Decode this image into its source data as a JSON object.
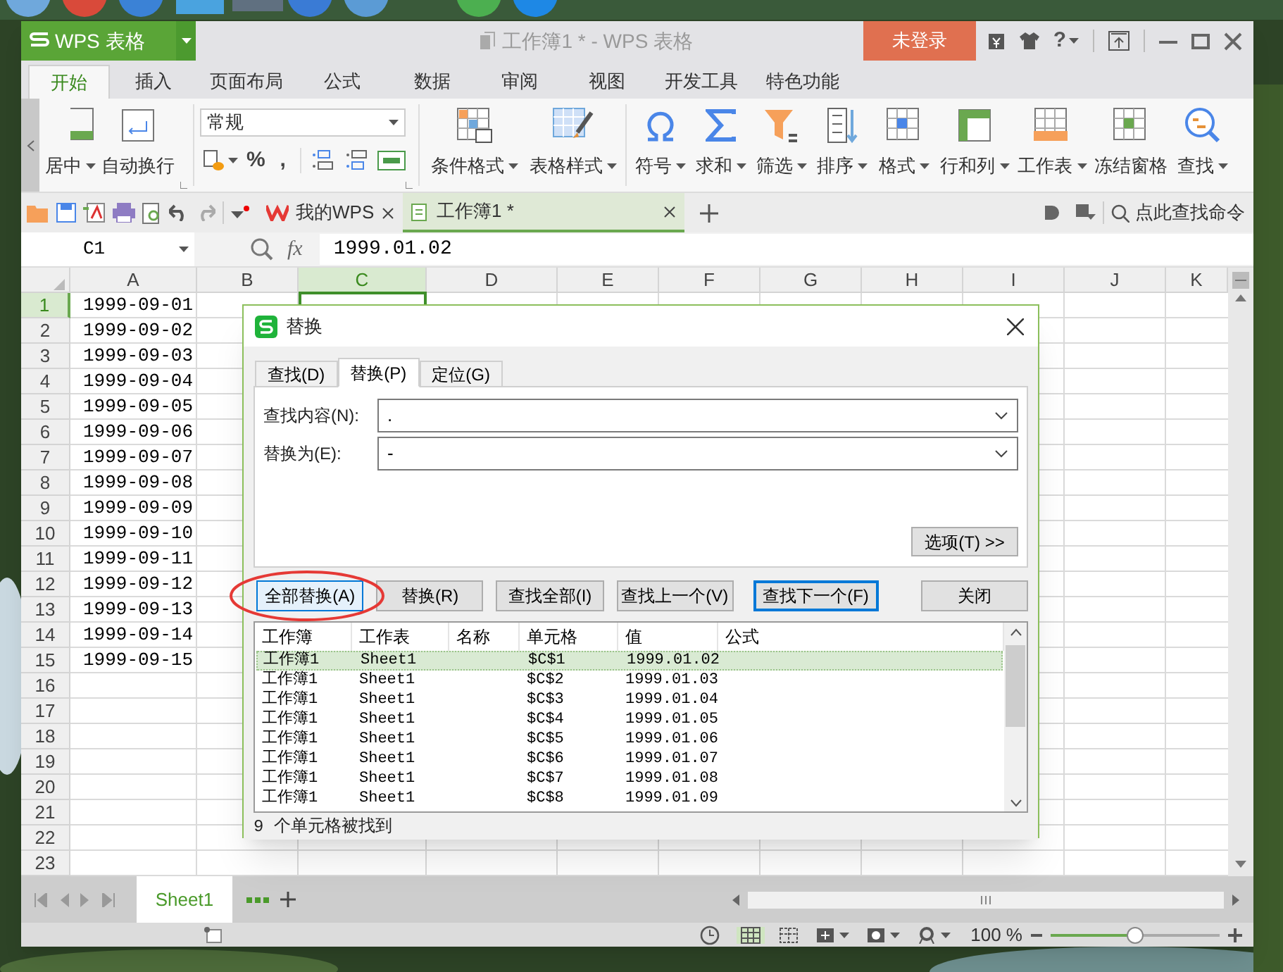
{
  "app_menu": {
    "label": "WPS 表格"
  },
  "window": {
    "title": "工作簿1 * - WPS 表格"
  },
  "login_button": "未登录",
  "help_button": "?",
  "ribbon_tabs": [
    {
      "label": "开始",
      "selected": true
    },
    {
      "label": "插入",
      "selected": false
    },
    {
      "label": "页面布局",
      "selected": false
    },
    {
      "label": "公式",
      "selected": false
    },
    {
      "label": "数据",
      "selected": false
    },
    {
      "label": "审阅",
      "selected": false
    },
    {
      "label": "视图",
      "selected": false
    },
    {
      "label": "开发工具",
      "selected": false
    },
    {
      "label": "特色功能",
      "selected": false
    }
  ],
  "ribbon": {
    "tools_left": [
      {
        "label": "居中",
        "dropdown": true
      },
      {
        "label": "自动换行",
        "dropdown": false
      }
    ],
    "number_format": {
      "value": "常规"
    },
    "number_symbols": [
      "%",
      ","
    ],
    "tools": [
      {
        "label": "条件格式",
        "dropdown": true
      },
      {
        "label": "表格样式",
        "dropdown": true
      },
      {
        "label": "符号",
        "dropdown": true
      },
      {
        "label": "求和",
        "dropdown": true
      },
      {
        "label": "筛选",
        "dropdown": true
      },
      {
        "label": "排序",
        "dropdown": true
      },
      {
        "label": "格式",
        "dropdown": true
      },
      {
        "label": "行和列",
        "dropdown": true
      },
      {
        "label": "工作表",
        "dropdown": true
      },
      {
        "label": "冻结窗格",
        "dropdown": false
      },
      {
        "label": "查找",
        "dropdown": true
      }
    ]
  },
  "doc_tabs": [
    {
      "label": "我的WPS",
      "selected": false
    },
    {
      "label": "工作簿1 *",
      "selected": true
    }
  ],
  "command_search": {
    "placeholder": "点此查找命令"
  },
  "formula_bar": {
    "name_box": "C1",
    "fx": "fx",
    "value": "1999.01.02"
  },
  "sheet": {
    "columns": [
      {
        "label": "A",
        "selected": false
      },
      {
        "label": "B",
        "selected": false
      },
      {
        "label": "C",
        "selected": true
      },
      {
        "label": "D",
        "selected": false
      },
      {
        "label": "E",
        "selected": false
      },
      {
        "label": "F",
        "selected": false
      },
      {
        "label": "G",
        "selected": false
      },
      {
        "label": "H",
        "selected": false
      },
      {
        "label": "I",
        "selected": false
      },
      {
        "label": "J",
        "selected": false
      },
      {
        "label": "K",
        "selected": false
      }
    ],
    "rows": [
      {
        "label": "1",
        "selected": true,
        "a": "1999-09-01"
      },
      {
        "label": "2",
        "selected": false,
        "a": "1999-09-02"
      },
      {
        "label": "3",
        "selected": false,
        "a": "1999-09-03"
      },
      {
        "label": "4",
        "selected": false,
        "a": "1999-09-04"
      },
      {
        "label": "5",
        "selected": false,
        "a": "1999-09-05"
      },
      {
        "label": "6",
        "selected": false,
        "a": "1999-09-06"
      },
      {
        "label": "7",
        "selected": false,
        "a": "1999-09-07"
      },
      {
        "label": "8",
        "selected": false,
        "a": "1999-09-08"
      },
      {
        "label": "9",
        "selected": false,
        "a": "1999-09-09"
      },
      {
        "label": "10",
        "selected": false,
        "a": "1999-09-10"
      },
      {
        "label": "11",
        "selected": false,
        "a": "1999-09-11"
      },
      {
        "label": "12",
        "selected": false,
        "a": "1999-09-12"
      },
      {
        "label": "13",
        "selected": false,
        "a": "1999-09-13"
      },
      {
        "label": "14",
        "selected": false,
        "a": "1999-09-14"
      },
      {
        "label": "15",
        "selected": false,
        "a": "1999-09-15"
      },
      {
        "label": "16",
        "selected": false
      },
      {
        "label": "17",
        "selected": false
      },
      {
        "label": "18",
        "selected": false
      },
      {
        "label": "19",
        "selected": false
      },
      {
        "label": "20",
        "selected": false
      },
      {
        "label": "21",
        "selected": false
      },
      {
        "label": "22",
        "selected": false
      },
      {
        "label": "23",
        "selected": false
      }
    ]
  },
  "sheet_tabs": [
    {
      "label": "Sheet1",
      "selected": true
    }
  ],
  "status_bar": {
    "zoom": "100 %",
    "zoom_slider": {
      "level": 0.5
    }
  },
  "dialog": {
    "title": "替换",
    "tabs": [
      {
        "label": "查找(D)",
        "selected": false
      },
      {
        "label": "替换(P)",
        "selected": true
      },
      {
        "label": "定位(G)",
        "selected": false
      }
    ],
    "fields": [
      {
        "label": "查找内容(N):",
        "value": "."
      },
      {
        "label": "替换为(E):",
        "value": "-"
      }
    ],
    "options_button": "选项(T) >>",
    "buttons": [
      {
        "label": "全部替换(A)",
        "focused": true,
        "default": false
      },
      {
        "label": "替换(R)",
        "focused": false,
        "default": false
      },
      {
        "label": "查找全部(I)",
        "focused": false,
        "default": false
      },
      {
        "label": "查找上一个(V)",
        "focused": false,
        "default": false
      },
      {
        "label": "查找下一个(F)",
        "focused": false,
        "default": true
      },
      {
        "label": "关闭",
        "focused": false,
        "default": false
      }
    ],
    "results": {
      "columns": [
        "工作簿",
        "工作表",
        "名称",
        "单元格",
        "值",
        "公式"
      ],
      "rows": [
        {
          "workbook": "工作簿1",
          "sheet": "Sheet1",
          "cell": "$C$1",
          "value": "1999.01.02",
          "selected": true
        },
        {
          "workbook": "工作簿1",
          "sheet": "Sheet1",
          "cell": "$C$2",
          "value": "1999.01.03",
          "selected": false
        },
        {
          "workbook": "工作簿1",
          "sheet": "Sheet1",
          "cell": "$C$3",
          "value": "1999.01.04",
          "selected": false
        },
        {
          "workbook": "工作簿1",
          "sheet": "Sheet1",
          "cell": "$C$4",
          "value": "1999.01.05",
          "selected": false
        },
        {
          "workbook": "工作簿1",
          "sheet": "Sheet1",
          "cell": "$C$5",
          "value": "1999.01.06",
          "selected": false
        },
        {
          "workbook": "工作簿1",
          "sheet": "Sheet1",
          "cell": "$C$6",
          "value": "1999.01.07",
          "selected": false
        },
        {
          "workbook": "工作簿1",
          "sheet": "Sheet1",
          "cell": "$C$7",
          "value": "1999.01.08",
          "selected": false
        },
        {
          "workbook": "工作簿1",
          "sheet": "Sheet1",
          "cell": "$C$8",
          "value": "1999.01.09",
          "selected": false
        }
      ]
    },
    "status": "9 个单元格被找到"
  }
}
